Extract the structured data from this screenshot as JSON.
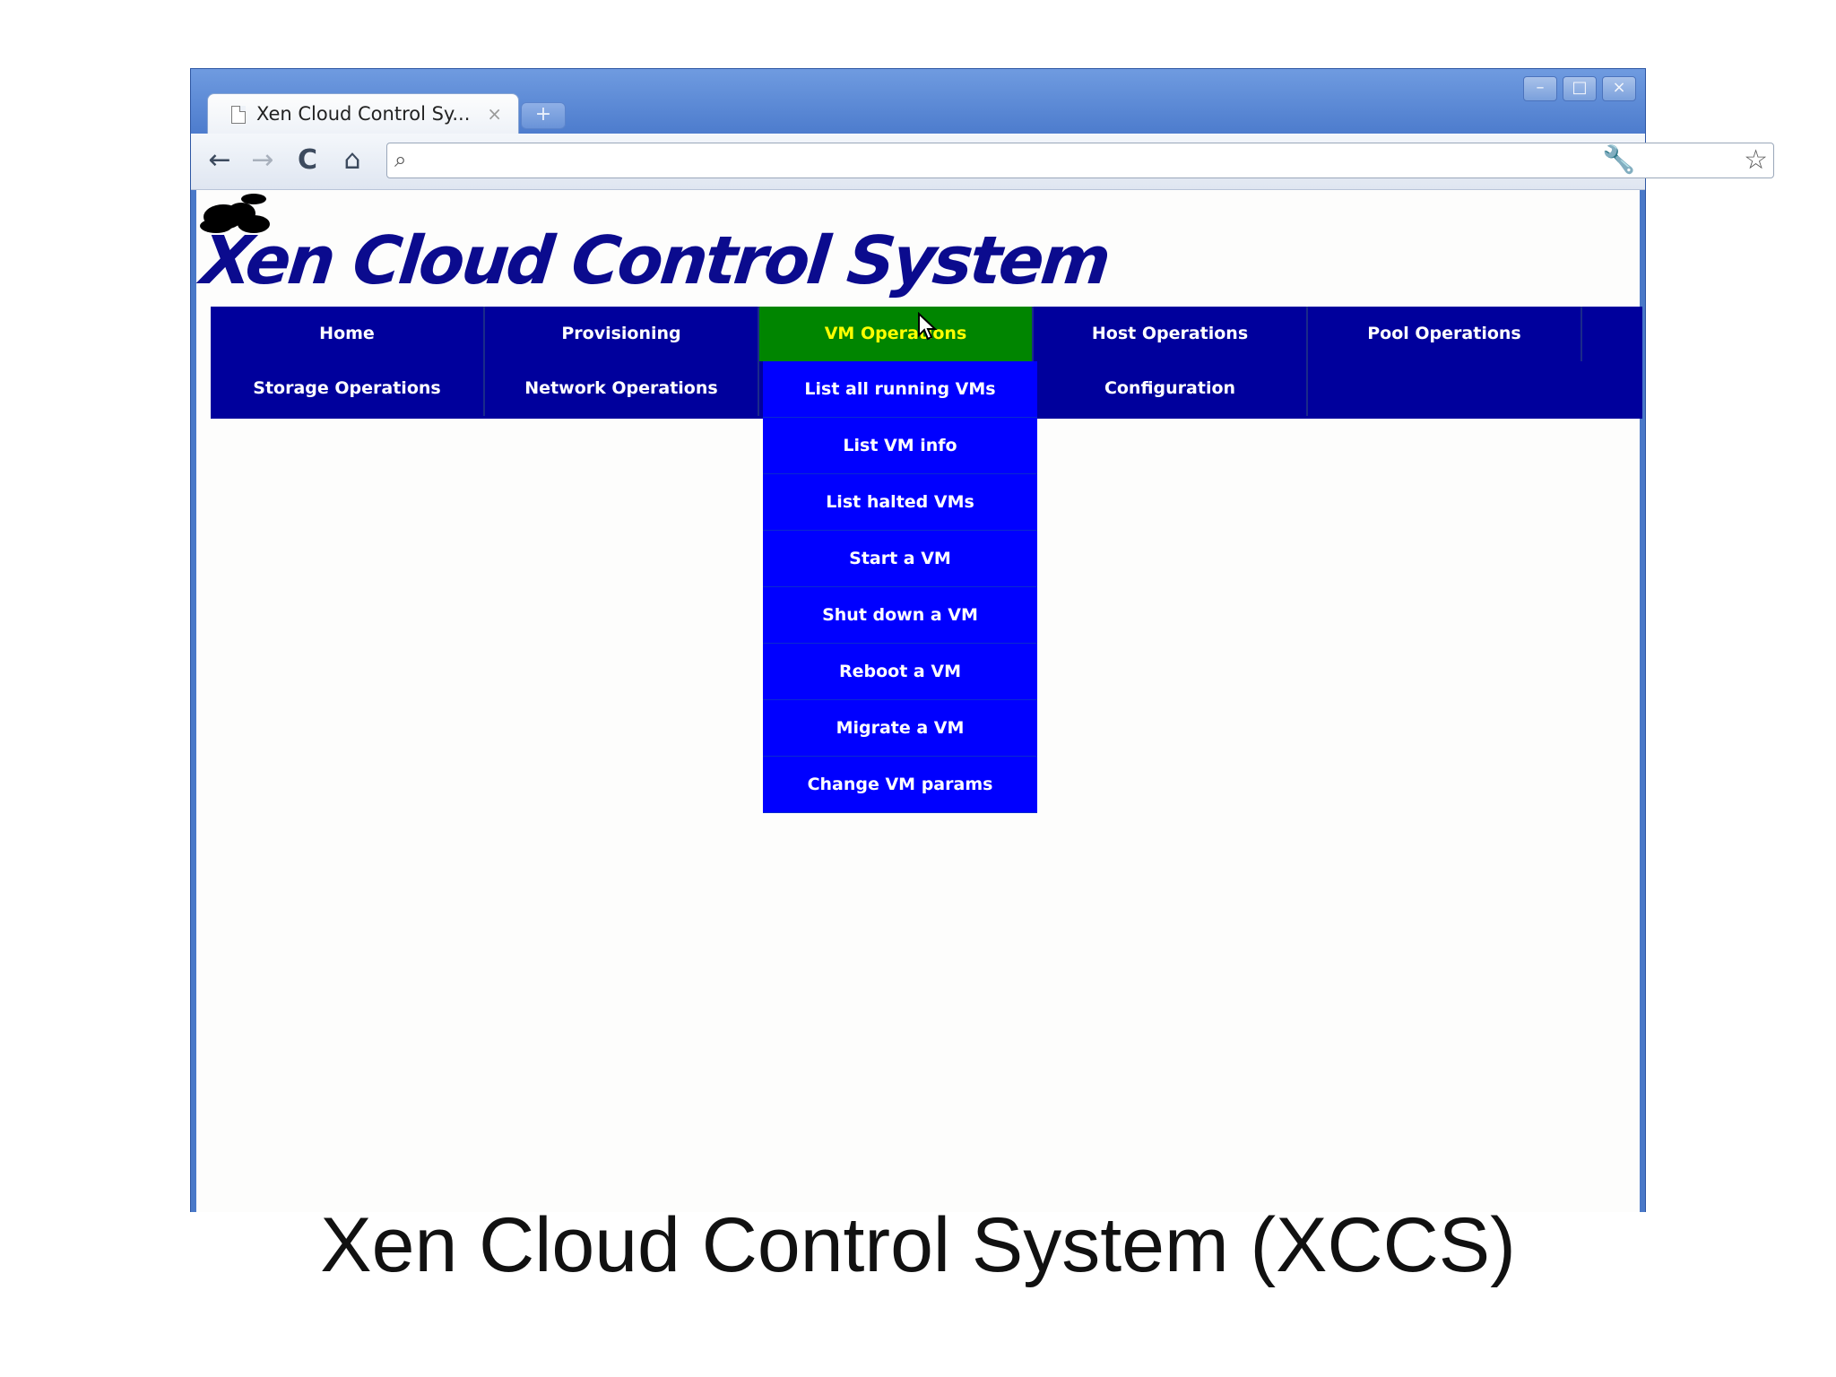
{
  "browser": {
    "tab_title": "Xen Cloud Control Sy...",
    "tab_close": "×",
    "new_tab": "+",
    "address": "",
    "window_controls": [
      "–",
      "□",
      "×"
    ]
  },
  "toolbar": {
    "back": "←",
    "forward": "→",
    "reload": "C",
    "home": "⌂",
    "search_glyph": "⌕",
    "star": "☆",
    "wrench": "🔧"
  },
  "site": {
    "logo_text": "Xen Cloud Control System",
    "menu": [
      {
        "label": "Home"
      },
      {
        "label": "Provisioning"
      },
      {
        "label": "VM Operations",
        "active": true
      },
      {
        "label": "Host Operations"
      },
      {
        "label": "Pool Operations"
      },
      {
        "label": "Storage Operations"
      },
      {
        "label": "Network Operations"
      },
      {
        "label": "Configuration"
      }
    ],
    "dropdown": [
      "List all running VMs",
      "List VM info",
      "List halted VMs",
      "Start a VM",
      "Shut down a VM",
      "Reboot a VM",
      "Migrate a VM",
      "Change VM params"
    ]
  },
  "caption": "Xen Cloud Control System (XCCS)",
  "colors": {
    "menu_bg": "#00009c",
    "menu_active_bg": "#008500",
    "menu_active_text": "#ffff00",
    "dropdown_bg": "#0000ff",
    "logo": "#0b0b8e"
  }
}
